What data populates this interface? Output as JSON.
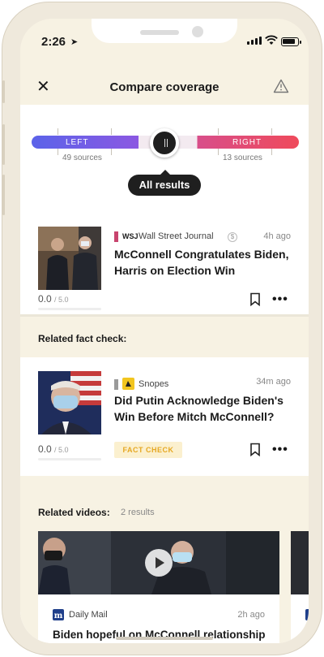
{
  "status": {
    "time": "2:26"
  },
  "header": {
    "title": "Compare coverage"
  },
  "bias": {
    "left_label": "LEFT",
    "left_sources": "49 sources",
    "right_label": "RIGHT",
    "right_sources": "13 sources",
    "selected": "All results"
  },
  "article": {
    "source_logo": "WSJ",
    "source_name": "Wall Street Journal",
    "source_color": "#c8446e",
    "paywall_icon": "$",
    "time_ago": "4h ago",
    "headline": "McConnell Congratulates Biden, Harris on Election Win",
    "score": "0.0",
    "score_max": "/ 5.0"
  },
  "fact_check": {
    "section_title": "Related fact check:",
    "source_name": "Snopes",
    "source_color": "#9a9a9a",
    "time_ago": "34m ago",
    "headline": "Did Putin Acknowledge Biden's Win Before Mitch McConnell?",
    "score": "0.0",
    "score_max": "/ 5.0",
    "badge": "FACT CHECK"
  },
  "videos": {
    "section_title": "Related videos:",
    "count": "2 results",
    "items": [
      {
        "source_name": "Daily Mail",
        "time_ago": "2h ago",
        "headline": "Biden hopeful on McConnell relationship"
      }
    ]
  }
}
